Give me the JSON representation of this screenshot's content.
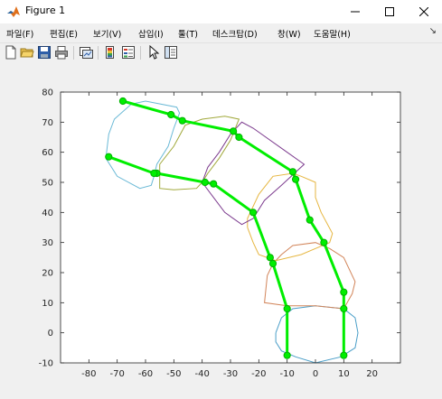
{
  "window": {
    "title": "Figure 1"
  },
  "menu": [
    "파일(F)",
    "편집(E)",
    "보기(V)",
    "삽입(I)",
    "툴(T)",
    "데스크탑(D)",
    "창(W)",
    "도움말(H)"
  ],
  "toolbar": [
    "new-figure-icon",
    "open-file-icon",
    "save-icon",
    "print-icon",
    "link-plot-icon",
    "colorbar-icon",
    "legend-icon",
    "pointer-icon",
    "property-editor-icon"
  ],
  "chart_data": {
    "type": "line",
    "title": "",
    "xlabel": "",
    "ylabel": "",
    "xlim": [
      -90,
      30
    ],
    "ylim": [
      -10,
      80
    ],
    "xticks": [
      -80,
      -70,
      -60,
      -50,
      -40,
      -30,
      -20,
      -10,
      0,
      10,
      20
    ],
    "yticks": [
      -10,
      0,
      10,
      20,
      30,
      40,
      50,
      60,
      70,
      80
    ],
    "grid": false,
    "skeleton": {
      "color": "#00ee00",
      "segments": [
        [
          [
            -10,
            -7.5
          ],
          [
            -10,
            8
          ]
        ],
        [
          [
            10,
            -7.5
          ],
          [
            10,
            8
          ]
        ],
        [
          [
            -10,
            8
          ],
          [
            -15,
            23
          ]
        ],
        [
          [
            10,
            8
          ],
          [
            10,
            13.5
          ]
        ],
        [
          [
            -15,
            23
          ],
          [
            -16,
            25
          ]
        ],
        [
          [
            10,
            13.5
          ],
          [
            3,
            30
          ]
        ],
        [
          [
            -16,
            25
          ],
          [
            -22,
            40
          ]
        ],
        [
          [
            3,
            30
          ],
          [
            -2,
            37.5
          ]
        ],
        [
          [
            -22,
            40
          ],
          [
            -36,
            49.5
          ]
        ],
        [
          [
            -2,
            37.5
          ],
          [
            -7,
            51
          ]
        ],
        [
          [
            -36,
            49.5
          ],
          [
            -39,
            50
          ]
        ],
        [
          [
            -7,
            51
          ],
          [
            -8,
            53.5
          ]
        ],
        [
          [
            -39,
            50
          ],
          [
            -56,
            53
          ]
        ],
        [
          [
            -8,
            53.5
          ],
          [
            -27,
            65
          ]
        ],
        [
          [
            -56,
            53
          ],
          [
            -57,
            53
          ]
        ],
        [
          [
            -27,
            65
          ],
          [
            -29,
            67
          ]
        ],
        [
          [
            -57,
            53
          ],
          [
            -73,
            58.5
          ]
        ],
        [
          [
            -29,
            67
          ],
          [
            -47,
            70.5
          ]
        ],
        [
          [
            -47,
            70.5
          ],
          [
            -51,
            72.5
          ]
        ],
        [
          [
            -51,
            72.5
          ],
          [
            -68,
            77
          ]
        ]
      ],
      "joints": [
        [
          -10,
          -7.5
        ],
        [
          10,
          -7.5
        ],
        [
          -10,
          8
        ],
        [
          10,
          8
        ],
        [
          -15,
          23
        ],
        [
          10,
          13.5
        ],
        [
          -16,
          25
        ],
        [
          3,
          30
        ],
        [
          -22,
          40
        ],
        [
          -2,
          37.5
        ],
        [
          -36,
          49.5
        ],
        [
          -7,
          51
        ],
        [
          -39,
          50
        ],
        [
          -8,
          53.5
        ],
        [
          -56,
          53
        ],
        [
          -27,
          65
        ],
        [
          -57,
          53
        ],
        [
          -29,
          67
        ],
        [
          -73,
          58.5
        ],
        [
          -47,
          70.5
        ],
        [
          -51,
          72.5
        ],
        [
          -68,
          77
        ]
      ]
    },
    "outlines": [
      {
        "color": "#4a9ec8",
        "points": [
          [
            -14,
            0
          ],
          [
            -12,
            5
          ],
          [
            -8,
            8
          ],
          [
            0,
            9
          ],
          [
            10,
            8
          ],
          [
            14,
            5
          ],
          [
            15,
            0
          ],
          [
            14,
            -5
          ],
          [
            9,
            -8
          ],
          [
            0,
            -10
          ],
          [
            -7,
            -8
          ],
          [
            -12,
            -6
          ],
          [
            -14,
            -3
          ],
          [
            -14,
            0
          ]
        ]
      },
      {
        "color": "#d2855a",
        "points": [
          [
            -15,
            23
          ],
          [
            -17,
            19
          ],
          [
            -18,
            10
          ],
          [
            -10,
            9
          ],
          [
            0,
            9
          ],
          [
            10,
            8
          ],
          [
            13,
            13
          ],
          [
            14,
            17
          ],
          [
            10,
            25
          ],
          [
            5,
            28
          ],
          [
            0,
            30
          ],
          [
            -8,
            29
          ],
          [
            -12,
            26
          ],
          [
            -15,
            23
          ]
        ]
      },
      {
        "color": "#e6b640",
        "points": [
          [
            -24,
            35
          ],
          [
            -22,
            30
          ],
          [
            -20,
            26
          ],
          [
            -14,
            24
          ],
          [
            -5,
            26
          ],
          [
            0,
            28
          ],
          [
            5,
            30
          ],
          [
            6,
            33
          ],
          [
            2,
            40
          ],
          [
            0,
            45
          ],
          [
            0,
            50
          ],
          [
            -5,
            52
          ],
          [
            -8,
            53
          ],
          [
            -15,
            52
          ],
          [
            -20,
            46
          ],
          [
            -24,
            38
          ],
          [
            -24,
            35
          ]
        ]
      },
      {
        "color": "#7c3b8e",
        "points": [
          [
            -40,
            50
          ],
          [
            -36,
            45
          ],
          [
            -32,
            40
          ],
          [
            -26,
            36
          ],
          [
            -22,
            38
          ],
          [
            -18,
            44
          ],
          [
            -12,
            49
          ],
          [
            -4,
            56
          ],
          [
            -10,
            60
          ],
          [
            -22,
            68
          ],
          [
            -26,
            70
          ],
          [
            -30,
            66
          ],
          [
            -34,
            60
          ],
          [
            -38,
            55
          ],
          [
            -40,
            50
          ]
        ]
      },
      {
        "color": "#a0a83a",
        "points": [
          [
            -55,
            56
          ],
          [
            -50,
            62
          ],
          [
            -46,
            69
          ],
          [
            -40,
            71
          ],
          [
            -32,
            72
          ],
          [
            -27,
            71
          ],
          [
            -30,
            64
          ],
          [
            -34,
            58
          ],
          [
            -38,
            53
          ],
          [
            -40,
            50
          ],
          [
            -42,
            48
          ],
          [
            -50,
            47.5
          ],
          [
            -55,
            48
          ],
          [
            -55,
            56
          ]
        ]
      },
      {
        "color": "#6ab9d6",
        "points": [
          [
            -74,
            58
          ],
          [
            -73,
            66
          ],
          [
            -71,
            71
          ],
          [
            -65,
            76
          ],
          [
            -60,
            77
          ],
          [
            -49,
            75
          ],
          [
            -48,
            73
          ],
          [
            -50,
            68
          ],
          [
            -52,
            62
          ],
          [
            -56,
            56
          ],
          [
            -57,
            52
          ],
          [
            -58,
            49
          ],
          [
            -62,
            48
          ],
          [
            -70,
            52
          ],
          [
            -74,
            58
          ]
        ]
      }
    ]
  }
}
